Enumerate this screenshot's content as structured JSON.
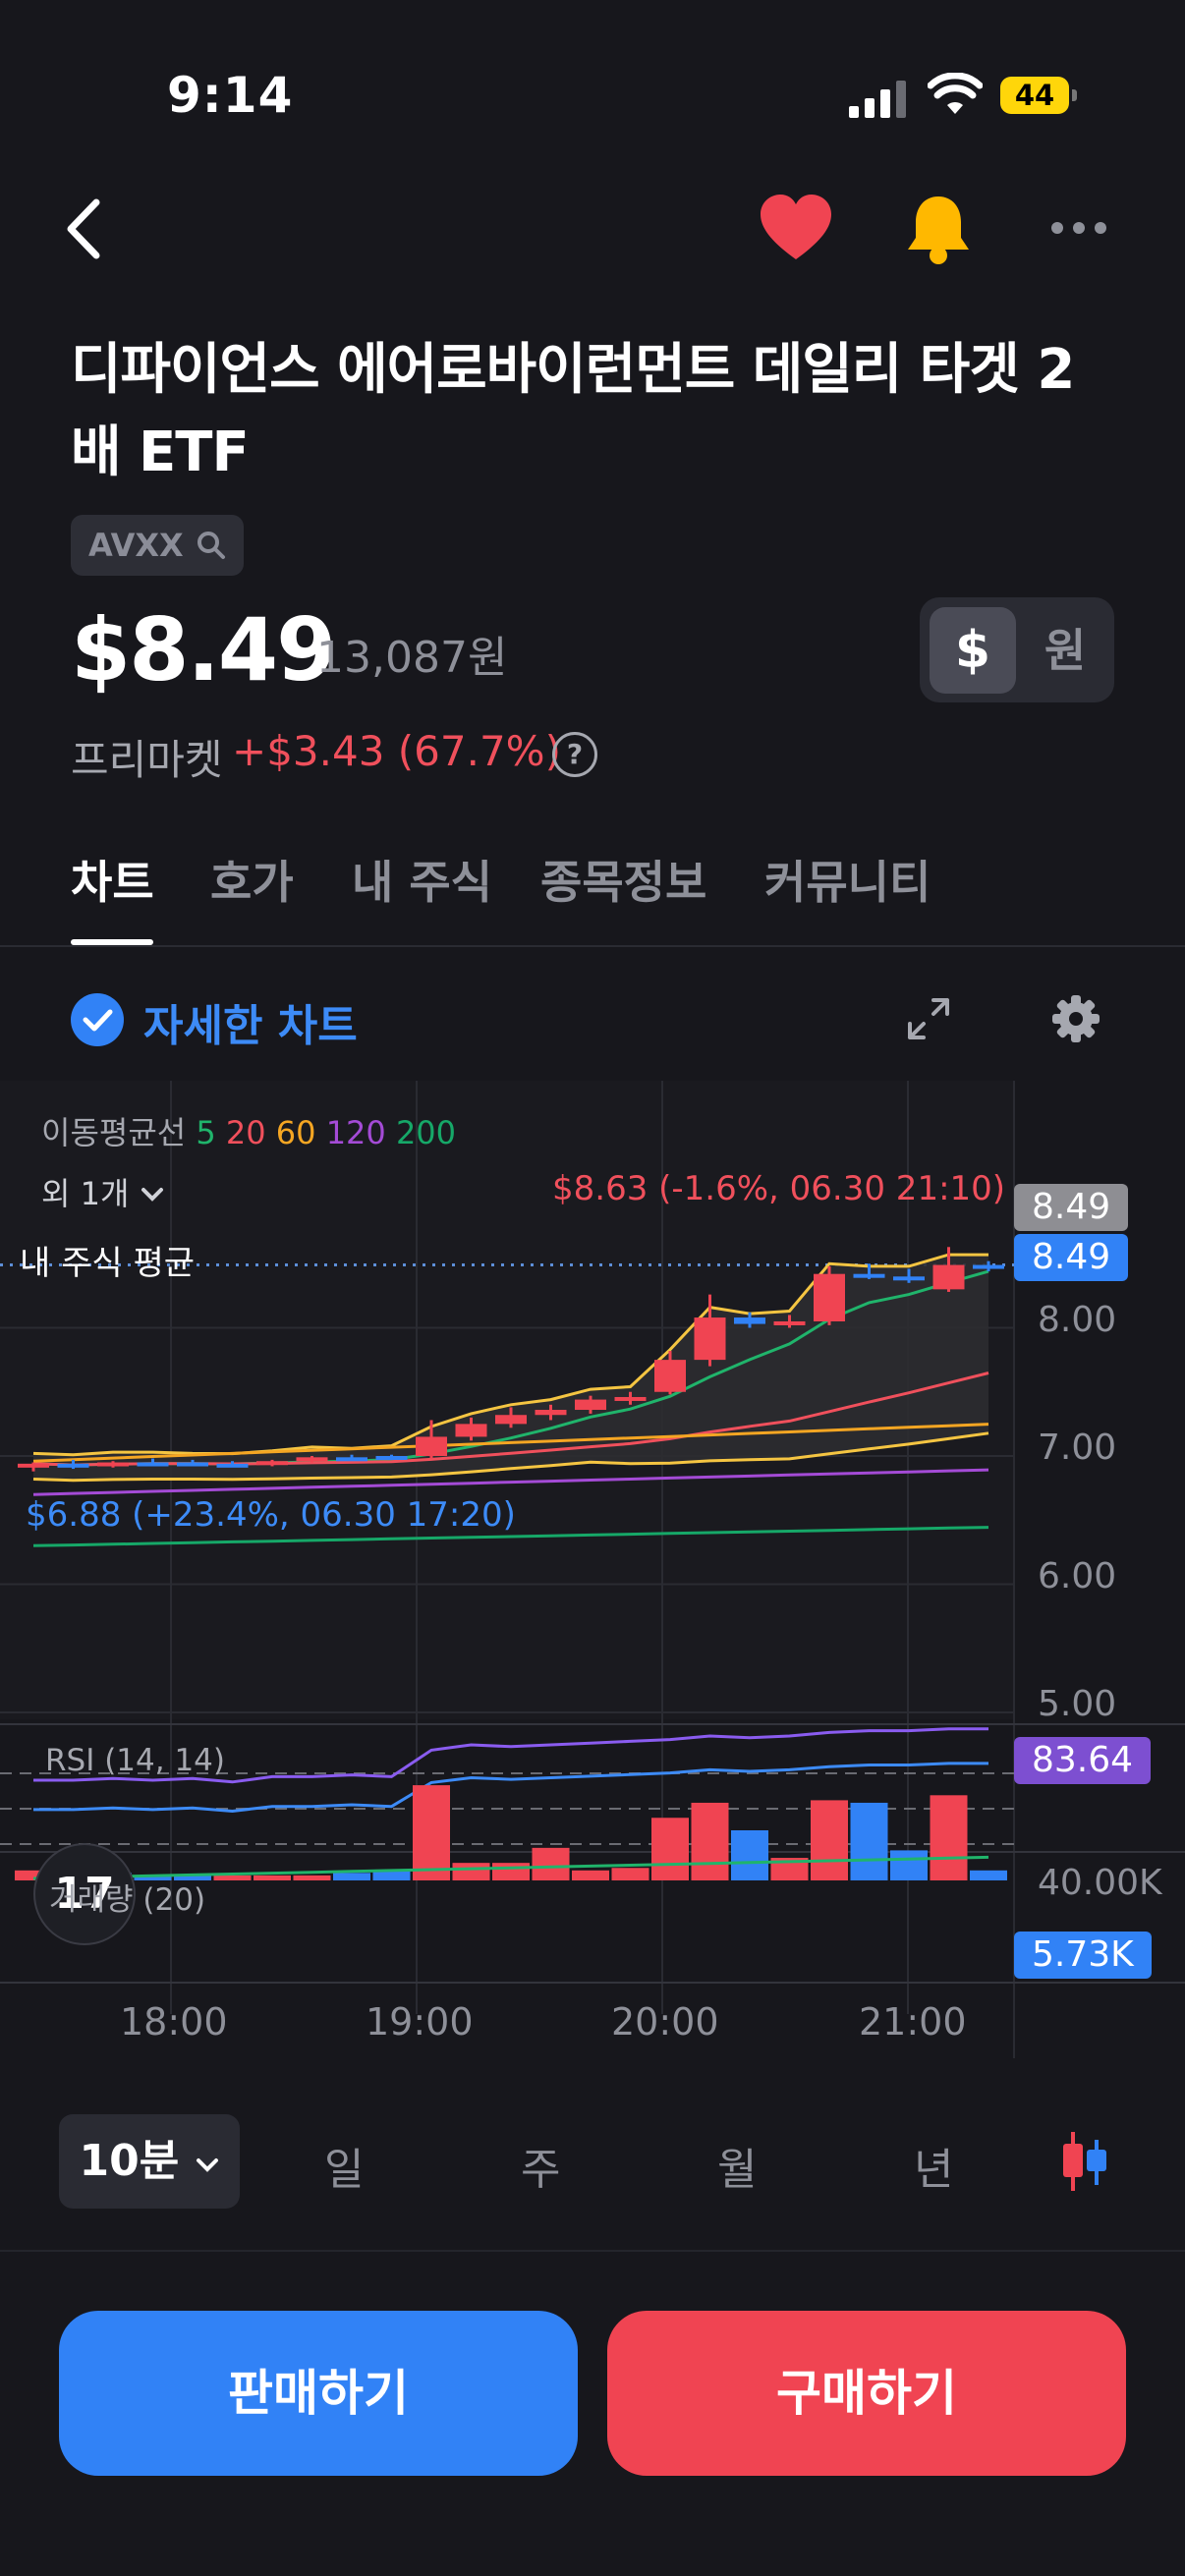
{
  "status_bar": {
    "time": "9:14",
    "battery": "44"
  },
  "header": {
    "icons": [
      "back-icon",
      "heart-icon",
      "bell-icon",
      "more-icon"
    ]
  },
  "stock": {
    "name": "디파이언스 에어로바이런먼트 데일리 타겟 2배 ETF",
    "ticker": "AVXX",
    "price": "$8.49",
    "price_krw": "13,087원",
    "premarket_label": "프리마켓",
    "premarket_change": "+$3.43 (67.7%)"
  },
  "currency_toggle": {
    "usd": "$",
    "krw": "원",
    "selected": "usd"
  },
  "tabs": [
    {
      "label": "차트",
      "active": true
    },
    {
      "label": "호가",
      "active": false
    },
    {
      "label": "내 주식",
      "active": false
    },
    {
      "label": "종목정보",
      "active": false
    },
    {
      "label": "커뮤니티",
      "active": false
    }
  ],
  "chart_toolbar": {
    "detail_chart_label": "자세한 차트"
  },
  "chart": {
    "ma_legend_label": "이동평균선",
    "ma_periods": [
      {
        "label": "5",
        "color": "#20b46b"
      },
      {
        "label": "20",
        "color": "#f0505c"
      },
      {
        "label": "60",
        "color": "#f5a623"
      },
      {
        "label": "120",
        "color": "#a44bd6"
      },
      {
        "label": "200",
        "color": "#16a868"
      }
    ],
    "more_indicators": "외 1개",
    "my_avg_label": "내 주식 평균",
    "high_annotation": "$8.63 (-1.6%, 06.30 21:10)",
    "low_annotation": "$6.88 (+23.4%, 06.30 17:20)",
    "price_axis": [
      "8.00",
      "7.00",
      "6.00",
      "5.00"
    ],
    "price_tag_gray": "8.49",
    "price_tag_blue": "8.49",
    "rsi_label": "RSI (14, 14)",
    "rsi_value": "83.64",
    "volume_label": "거래량 (20)",
    "volume_axis": "40.00K",
    "volume_value": "5.73K",
    "time_axis": [
      "18:00",
      "19:00",
      "20:00",
      "21:00"
    ],
    "tv_logo": "17"
  },
  "chart_data": {
    "type": "candlestick",
    "x_ticks": [
      "18:00",
      "19:00",
      "20:00",
      "21:00"
    ],
    "price_ylim": [
      5.0,
      8.5
    ],
    "candles": [
      {
        "o": 6.92,
        "h": 6.95,
        "l": 6.88,
        "c": 6.94,
        "up": true
      },
      {
        "o": 6.94,
        "h": 6.97,
        "l": 6.9,
        "c": 6.92,
        "up": false
      },
      {
        "o": 6.93,
        "h": 6.96,
        "l": 6.91,
        "c": 6.95,
        "up": true
      },
      {
        "o": 6.95,
        "h": 6.98,
        "l": 6.92,
        "c": 6.95,
        "up": false
      },
      {
        "o": 6.95,
        "h": 6.97,
        "l": 6.93,
        "c": 6.94,
        "up": false
      },
      {
        "o": 6.94,
        "h": 6.96,
        "l": 6.92,
        "c": 6.93,
        "up": false
      },
      {
        "o": 6.93,
        "h": 6.97,
        "l": 6.92,
        "c": 6.96,
        "up": true
      },
      {
        "o": 6.96,
        "h": 7.0,
        "l": 6.95,
        "c": 6.99,
        "up": true
      },
      {
        "o": 6.99,
        "h": 7.01,
        "l": 6.97,
        "c": 6.98,
        "up": false
      },
      {
        "o": 6.98,
        "h": 7.01,
        "l": 6.97,
        "c": 7.0,
        "up": false
      },
      {
        "o": 7.0,
        "h": 7.28,
        "l": 6.98,
        "c": 7.15,
        "up": true
      },
      {
        "o": 7.15,
        "h": 7.3,
        "l": 7.12,
        "c": 7.25,
        "up": true
      },
      {
        "o": 7.25,
        "h": 7.38,
        "l": 7.22,
        "c": 7.32,
        "up": true
      },
      {
        "o": 7.32,
        "h": 7.4,
        "l": 7.28,
        "c": 7.36,
        "up": true
      },
      {
        "o": 7.36,
        "h": 7.47,
        "l": 7.33,
        "c": 7.44,
        "up": true
      },
      {
        "o": 7.44,
        "h": 7.5,
        "l": 7.4,
        "c": 7.46,
        "up": true
      },
      {
        "o": 7.5,
        "h": 7.82,
        "l": 7.48,
        "c": 7.75,
        "up": true
      },
      {
        "o": 7.75,
        "h": 8.26,
        "l": 7.7,
        "c": 8.08,
        "up": true
      },
      {
        "o": 8.08,
        "h": 8.12,
        "l": 8.0,
        "c": 8.03,
        "up": false
      },
      {
        "o": 8.03,
        "h": 8.1,
        "l": 8.0,
        "c": 8.05,
        "up": true
      },
      {
        "o": 8.05,
        "h": 8.48,
        "l": 8.02,
        "c": 8.42,
        "up": true
      },
      {
        "o": 8.42,
        "h": 8.5,
        "l": 8.38,
        "c": 8.4,
        "up": false
      },
      {
        "o": 8.4,
        "h": 8.46,
        "l": 8.35,
        "c": 8.4,
        "up": false
      },
      {
        "o": 8.3,
        "h": 8.63,
        "l": 8.28,
        "c": 8.49,
        "up": true
      },
      {
        "o": 8.49,
        "h": 8.52,
        "l": 8.44,
        "c": 8.49,
        "up": false
      }
    ],
    "volume": [
      4,
      2,
      3,
      2,
      2,
      2,
      2,
      2,
      3,
      4,
      38,
      7,
      7,
      13,
      4,
      5,
      25,
      31,
      20,
      9,
      32,
      31,
      12,
      34,
      4
    ],
    "volume_up": [
      true,
      true,
      false,
      false,
      false,
      true,
      true,
      true,
      false,
      false,
      true,
      true,
      true,
      true,
      true,
      true,
      true,
      true,
      false,
      true,
      true,
      false,
      false,
      true,
      false
    ],
    "rsi": [
      55,
      55,
      56,
      55,
      56,
      54,
      57,
      57,
      58,
      57,
      72,
      75,
      74,
      75,
      76,
      77,
      78,
      80,
      79,
      80,
      82,
      83,
      83,
      84,
      84
    ]
  },
  "periods": {
    "selected": "10분",
    "options": [
      "일",
      "주",
      "월",
      "년"
    ]
  },
  "actions": {
    "sell": "판매하기",
    "buy": "구매하기"
  }
}
